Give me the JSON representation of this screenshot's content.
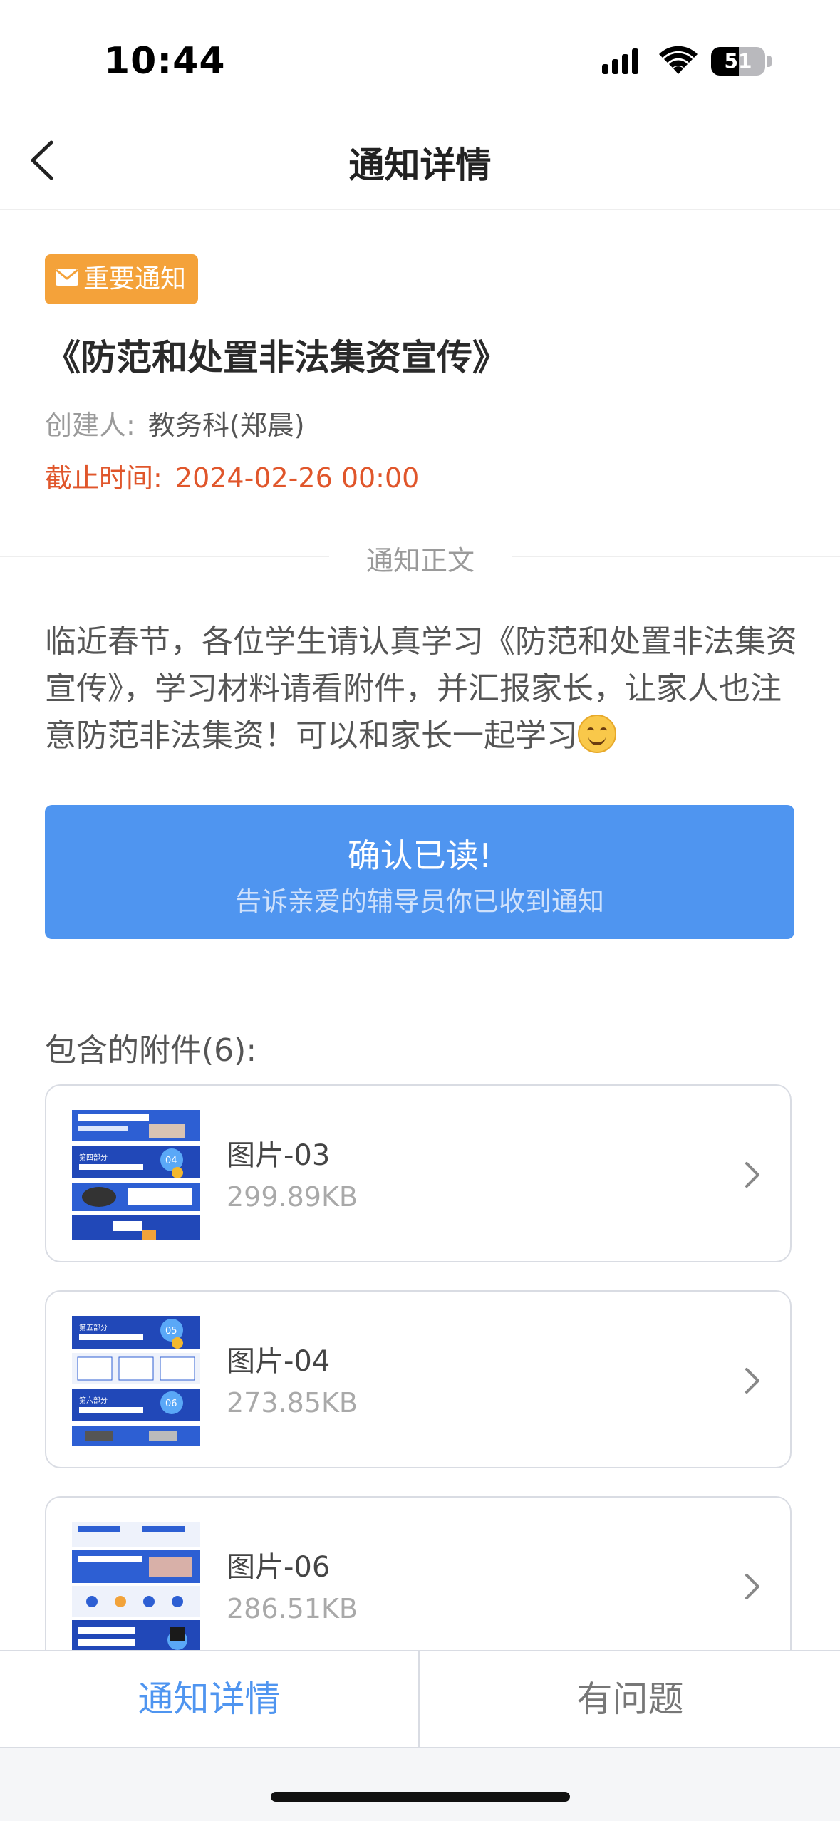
{
  "status_bar": {
    "time": "10:44",
    "battery_level": "51",
    "battery_percent": 51
  },
  "nav": {
    "title": "通知详情"
  },
  "notice": {
    "tag": "重要通知",
    "title": "《防范和处置非法集资宣传》",
    "creator_label": "创建人:",
    "creator_value": "教务科(郑晨)",
    "deadline_label": "截止时间:",
    "deadline_value": "2024-02-26 00:00"
  },
  "divider": {
    "label": "通知正文"
  },
  "body": {
    "text": "临近春节，各位学生请认真学习《防范和处置非法集资宣传》，学习材料请看附件，并汇报家长，让家人也注意防范非法集资！可以和家长一起学习"
  },
  "confirm": {
    "title": "确认已读!",
    "subtitle": "告诉亲爱的辅导员你已收到通知"
  },
  "attachments": {
    "header": "包含的附件(6):",
    "items": [
      {
        "name": "图片-03",
        "size": "299.89KB"
      },
      {
        "name": "图片-04",
        "size": "273.85KB"
      },
      {
        "name": "图片-06",
        "size": "286.51KB"
      }
    ]
  },
  "tabs": {
    "left": "通知详情",
    "right": "有问题"
  },
  "colors": {
    "accent": "#4f95f0",
    "tag": "#f4a23a",
    "deadline": "#e0562b"
  }
}
